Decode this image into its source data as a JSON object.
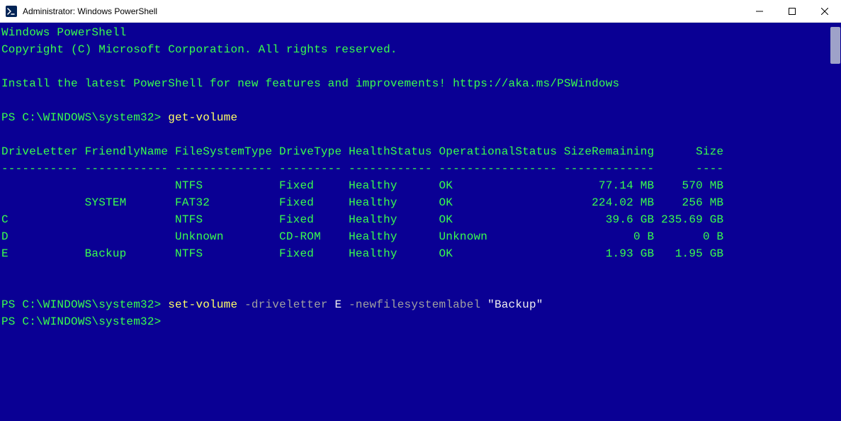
{
  "window": {
    "title": "Administrator: Windows PowerShell"
  },
  "lines": [
    {
      "segments": [
        {
          "text": "Windows PowerShell",
          "cls": "c-green"
        }
      ]
    },
    {
      "segments": [
        {
          "text": "Copyright (C) Microsoft Corporation. All rights reserved.",
          "cls": "c-green"
        }
      ]
    },
    {
      "segments": [
        {
          "text": " ",
          "cls": "c-green"
        }
      ]
    },
    {
      "segments": [
        {
          "text": "Install the latest PowerShell for new features and improvements! https://aka.ms/PSWindows",
          "cls": "c-green"
        }
      ]
    },
    {
      "segments": [
        {
          "text": " ",
          "cls": "c-green"
        }
      ]
    },
    {
      "segments": [
        {
          "text": "PS C:\\WINDOWS\\system32> ",
          "cls": "c-green"
        },
        {
          "text": "get-volume",
          "cls": "c-yellow"
        }
      ]
    },
    {
      "segments": [
        {
          "text": " ",
          "cls": "c-green"
        }
      ]
    },
    {
      "segments": [
        {
          "text": "DriveLetter FriendlyName FileSystemType DriveType HealthStatus OperationalStatus SizeRemaining      Size",
          "cls": "c-green"
        }
      ]
    },
    {
      "segments": [
        {
          "text": "----------- ------------ -------------- --------- ------------ ----------------- -------------      ----",
          "cls": "c-green"
        }
      ]
    },
    {
      "segments": [
        {
          "text": "                         NTFS           Fixed     Healthy      OK                     77.14 MB    570 MB",
          "cls": "c-green"
        }
      ]
    },
    {
      "segments": [
        {
          "text": "            SYSTEM       FAT32          Fixed     Healthy      OK                    224.02 MB    256 MB",
          "cls": "c-green"
        }
      ]
    },
    {
      "segments": [
        {
          "text": "C                        NTFS           Fixed     Healthy      OK                      39.6 GB 235.69 GB",
          "cls": "c-green"
        }
      ]
    },
    {
      "segments": [
        {
          "text": "D                        Unknown        CD-ROM    Healthy      Unknown                     0 B       0 B",
          "cls": "c-green"
        }
      ]
    },
    {
      "segments": [
        {
          "text": "E           Backup       NTFS           Fixed     Healthy      OK                      1.93 GB   1.95 GB",
          "cls": "c-green"
        }
      ]
    },
    {
      "segments": [
        {
          "text": " ",
          "cls": "c-green"
        }
      ]
    },
    {
      "segments": [
        {
          "text": " ",
          "cls": "c-green"
        }
      ]
    },
    {
      "segments": [
        {
          "text": "PS C:\\WINDOWS\\system32> ",
          "cls": "c-green"
        },
        {
          "text": "set-volume ",
          "cls": "c-yellow"
        },
        {
          "text": "-driveletter ",
          "cls": "c-gray"
        },
        {
          "text": "E ",
          "cls": "c-white"
        },
        {
          "text": "-newfilesystemlabel ",
          "cls": "c-gray"
        },
        {
          "text": "\"Backup\"",
          "cls": "c-white"
        }
      ]
    },
    {
      "segments": [
        {
          "text": "PS C:\\WINDOWS\\system32>",
          "cls": "c-green"
        }
      ]
    }
  ],
  "table": {
    "columns": [
      "DriveLetter",
      "FriendlyName",
      "FileSystemType",
      "DriveType",
      "HealthStatus",
      "OperationalStatus",
      "SizeRemaining",
      "Size"
    ],
    "rows": [
      {
        "DriveLetter": "",
        "FriendlyName": "",
        "FileSystemType": "NTFS",
        "DriveType": "Fixed",
        "HealthStatus": "Healthy",
        "OperationalStatus": "OK",
        "SizeRemaining": "77.14 MB",
        "Size": "570 MB"
      },
      {
        "DriveLetter": "",
        "FriendlyName": "SYSTEM",
        "FileSystemType": "FAT32",
        "DriveType": "Fixed",
        "HealthStatus": "Healthy",
        "OperationalStatus": "OK",
        "SizeRemaining": "224.02 MB",
        "Size": "256 MB"
      },
      {
        "DriveLetter": "C",
        "FriendlyName": "",
        "FileSystemType": "NTFS",
        "DriveType": "Fixed",
        "HealthStatus": "Healthy",
        "OperationalStatus": "OK",
        "SizeRemaining": "39.6 GB",
        "Size": "235.69 GB"
      },
      {
        "DriveLetter": "D",
        "FriendlyName": "",
        "FileSystemType": "Unknown",
        "DriveType": "CD-ROM",
        "HealthStatus": "Healthy",
        "OperationalStatus": "Unknown",
        "SizeRemaining": "0 B",
        "Size": "0 B"
      },
      {
        "DriveLetter": "E",
        "FriendlyName": "Backup",
        "FileSystemType": "NTFS",
        "DriveType": "Fixed",
        "HealthStatus": "Healthy",
        "OperationalStatus": "OK",
        "SizeRemaining": "1.93 GB",
        "Size": "1.95 GB"
      }
    ]
  },
  "commands": {
    "first": {
      "prompt": "PS C:\\WINDOWS\\system32>",
      "cmdlet": "get-volume"
    },
    "second": {
      "prompt": "PS C:\\WINDOWS\\system32>",
      "cmdlet": "set-volume",
      "param1": "-driveletter",
      "arg1": "E",
      "param2": "-newfilesystemlabel",
      "arg2": "\"Backup\""
    },
    "third_prompt": "PS C:\\WINDOWS\\system32>"
  }
}
